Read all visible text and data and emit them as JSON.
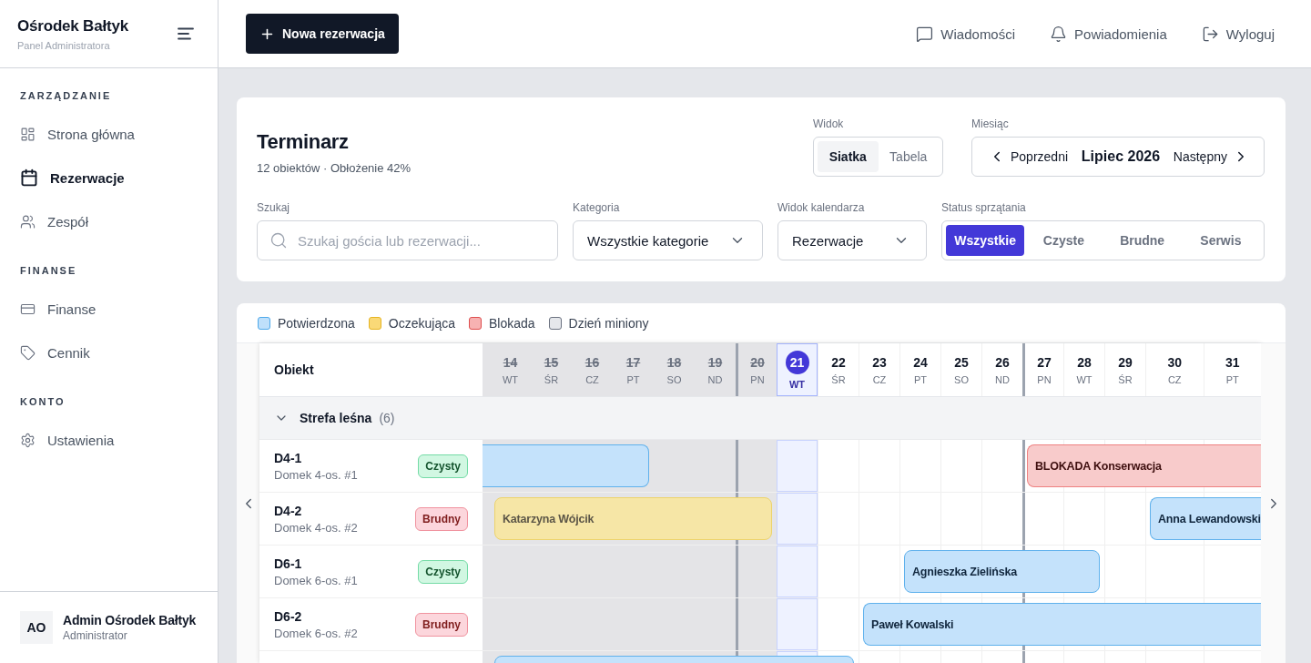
{
  "sidebar": {
    "brand": "Ośrodek Bałtyk",
    "subtitle": "Panel Administratora",
    "sections": [
      {
        "heading": "ZARZĄDZANIE",
        "items": [
          {
            "label": "Strona główna",
            "selected": false
          },
          {
            "label": "Rezerwacje",
            "selected": true
          },
          {
            "label": "Zespół",
            "selected": false
          }
        ]
      },
      {
        "heading": "FINANSE",
        "items": [
          {
            "label": "Finanse",
            "selected": false
          },
          {
            "label": "Cennik",
            "selected": false
          }
        ]
      },
      {
        "heading": "KONTO",
        "items": [
          {
            "label": "Ustawienia",
            "selected": false
          }
        ]
      }
    ],
    "user": {
      "initials": "AO",
      "name": "Admin Ośrodek Bałtyk",
      "role": "Administrator"
    }
  },
  "topbar": {
    "new_button": "Nowa rezerwacja",
    "actions": [
      "Wiadomości",
      "Powiadomienia",
      "Wyloguj"
    ]
  },
  "header": {
    "title": "Terminarz",
    "summary": "12 obiektów · Obłożenie 42%",
    "view": {
      "label": "Widok",
      "options": [
        {
          "label": "Siatka",
          "selected": true
        },
        {
          "label": "Tabela",
          "selected": false
        }
      ]
    },
    "month": {
      "label": "Miesiąc",
      "prev": "Poprzedni",
      "current": "Lipiec 2026",
      "next": "Następny"
    }
  },
  "filters": {
    "search": {
      "label": "Szukaj",
      "placeholder": "Szukaj gościa lub rezerwacji..."
    },
    "category": {
      "label": "Kategoria",
      "value": "Wszystkie kategorie"
    },
    "calendar_view": {
      "label": "Widok kalendarza",
      "value": "Rezerwacje"
    },
    "cleaning_status": {
      "label": "Status sprzątania",
      "options": [
        {
          "label": "Wszystkie",
          "selected": true
        },
        {
          "label": "Czyste",
          "selected": false
        },
        {
          "label": "Brudne",
          "selected": false
        },
        {
          "label": "Serwis",
          "selected": false
        }
      ]
    }
  },
  "legend": [
    {
      "label": "Potwierdzona",
      "kind": "confirmed"
    },
    {
      "label": "Oczekująca",
      "kind": "pending"
    },
    {
      "label": "Blokada",
      "kind": "block"
    },
    {
      "label": "Dzień miniony",
      "kind": "past"
    }
  ],
  "calendar": {
    "object_heading": "Obiekt",
    "days": [
      {
        "number": "14",
        "weekday": "WT",
        "past": true,
        "today": false,
        "week_start": false
      },
      {
        "number": "15",
        "weekday": "ŚR",
        "past": true,
        "today": false,
        "week_start": false
      },
      {
        "number": "16",
        "weekday": "CZ",
        "past": true,
        "today": false,
        "week_start": false
      },
      {
        "number": "17",
        "weekday": "PT",
        "past": true,
        "today": false,
        "week_start": false
      },
      {
        "number": "18",
        "weekday": "SO",
        "past": true,
        "today": false,
        "week_start": false
      },
      {
        "number": "19",
        "weekday": "ND",
        "past": true,
        "today": false,
        "week_start": false
      },
      {
        "number": "20",
        "weekday": "PN",
        "past": true,
        "today": false,
        "week_start": true
      },
      {
        "number": "21",
        "weekday": "WT",
        "past": false,
        "today": true,
        "week_start": false
      },
      {
        "number": "22",
        "weekday": "ŚR",
        "past": false,
        "today": false,
        "week_start": false
      },
      {
        "number": "23",
        "weekday": "CZ",
        "past": false,
        "today": false,
        "week_start": false
      },
      {
        "number": "24",
        "weekday": "PT",
        "past": false,
        "today": false,
        "week_start": false
      },
      {
        "number": "25",
        "weekday": "SO",
        "past": false,
        "today": false,
        "week_start": false
      },
      {
        "number": "26",
        "weekday": "ND",
        "past": false,
        "today": false,
        "week_start": false
      },
      {
        "number": "27",
        "weekday": "PN",
        "past": false,
        "today": false,
        "week_start": true
      },
      {
        "number": "28",
        "weekday": "WT",
        "past": false,
        "today": false,
        "week_start": false
      },
      {
        "number": "29",
        "weekday": "ŚR",
        "past": false,
        "today": false,
        "week_start": false
      },
      {
        "number": "30",
        "weekday": "CZ",
        "past": false,
        "today": false,
        "week_start": false
      },
      {
        "number": "31",
        "weekday": "PT",
        "past": false,
        "today": false,
        "week_start": false
      }
    ],
    "groups": [
      {
        "name": "Strefa leśna",
        "count": "(6)",
        "expanded": true,
        "rows": [
          {
            "code": "D4-1",
            "description": "Domek 4-os. #1",
            "status": {
              "label": "Czysty",
              "kind": "clean"
            },
            "cells": [
              {
                "kind": "confirmed"
              },
              {
                "kind": "confirmed"
              },
              {
                "kind": "confirmed"
              },
              {
                "kind": "confirmed"
              },
              {
                "kind": "free"
              },
              {
                "kind": "free"
              },
              {
                "kind": "free"
              },
              {
                "kind": "free"
              },
              {
                "kind": "free"
              },
              {
                "kind": "free"
              },
              {
                "kind": "free"
              },
              {
                "kind": "free"
              },
              {
                "kind": "free"
              },
              {
                "kind": "block"
              },
              {
                "kind": "block"
              },
              {
                "kind": "block"
              },
              {
                "kind": "block"
              },
              {
                "kind": "block"
              }
            ],
            "bookings": [
              {
                "open_start": true,
                "open_end": false
              },
              {
                "label": "BLOKADA Konserwacja",
                "open_start": false,
                "open_end": true
              }
            ]
          },
          {
            "code": "D4-2",
            "description": "Domek 4-os. #2",
            "status": {
              "label": "Brudny",
              "kind": "dirty"
            },
            "cells": [
              {
                "kind": "pending"
              },
              {
                "kind": "pending"
              },
              {
                "kind": "pending"
              },
              {
                "kind": "pending"
              },
              {
                "kind": "pending"
              },
              {
                "kind": "pending"
              },
              {
                "kind": "pending"
              },
              {
                "kind": "free"
              },
              {
                "kind": "free"
              },
              {
                "kind": "free"
              },
              {
                "kind": "free"
              },
              {
                "kind": "free"
              },
              {
                "kind": "free"
              },
              {
                "kind": "free"
              },
              {
                "kind": "free"
              },
              {
                "kind": "free"
              },
              {
                "kind": "confirmed"
              },
              {
                "kind": "confirmed"
              }
            ],
            "bookings": [
              {
                "label": "Katarzyna Wójcik",
                "open_start": false,
                "open_end": false
              },
              {
                "label": "Anna Lewandowski",
                "open_start": false,
                "open_end": true
              }
            ]
          },
          {
            "code": "D6-1",
            "description": "Domek 6-os. #1",
            "status": {
              "label": "Czysty",
              "kind": "clean"
            },
            "cells": [
              {
                "kind": "free"
              },
              {
                "kind": "free"
              },
              {
                "kind": "free"
              },
              {
                "kind": "free"
              },
              {
                "kind": "free"
              },
              {
                "kind": "free"
              },
              {
                "kind": "free"
              },
              {
                "kind": "free"
              },
              {
                "kind": "free"
              },
              {
                "kind": "free"
              },
              {
                "kind": "confirmed"
              },
              {
                "kind": "confirmed"
              },
              {
                "kind": "confirmed"
              },
              {
                "kind": "confirmed"
              },
              {
                "kind": "confirmed"
              },
              {
                "kind": "free"
              },
              {
                "kind": "free"
              },
              {
                "kind": "free"
              }
            ],
            "bookings": [
              {
                "label": "Agnieszka Zielińska",
                "open_start": false,
                "open_end": false
              }
            ]
          },
          {
            "code": "D6-2",
            "description": "Domek 6-os. #2",
            "status": {
              "label": "Brudny",
              "kind": "dirty"
            },
            "cells": [
              {
                "kind": "free"
              },
              {
                "kind": "free"
              },
              {
                "kind": "free"
              },
              {
                "kind": "free"
              },
              {
                "kind": "free"
              },
              {
                "kind": "free"
              },
              {
                "kind": "free"
              },
              {
                "kind": "free"
              },
              {
                "kind": "free"
              },
              {
                "kind": "confirmed"
              },
              {
                "kind": "confirmed"
              },
              {
                "kind": "confirmed"
              },
              {
                "kind": "confirmed"
              },
              {
                "kind": "confirmed"
              },
              {
                "kind": "confirmed"
              },
              {
                "kind": "confirmed"
              },
              {
                "kind": "confirmed"
              },
              {
                "kind": "confirmed"
              }
            ],
            "bookings": [
              {
                "label": "Paweł Kowalski",
                "open_start": false,
                "open_end": true
              }
            ]
          },
          {
            "cells": [
              {
                "kind": "confirmed"
              },
              {
                "kind": "confirmed"
              },
              {
                "kind": "confirmed"
              },
              {
                "kind": "confirmed"
              },
              {
                "kind": "confirmed"
              },
              {
                "kind": "confirmed"
              },
              {
                "kind": "confirmed"
              },
              {
                "kind": "confirmed"
              },
              {
                "kind": "confirmed"
              },
              {
                "kind": "free"
              },
              {
                "kind": "free"
              },
              {
                "kind": "free"
              },
              {
                "kind": "free"
              },
              {
                "kind": "free"
              },
              {
                "kind": "free"
              },
              {
                "kind": "free"
              },
              {
                "kind": "free"
              },
              {
                "kind": "free"
              }
            ],
            "bookings": [
              {
                "open_start": false,
                "open_end": false
              }
            ]
          }
        ]
      }
    ]
  }
}
